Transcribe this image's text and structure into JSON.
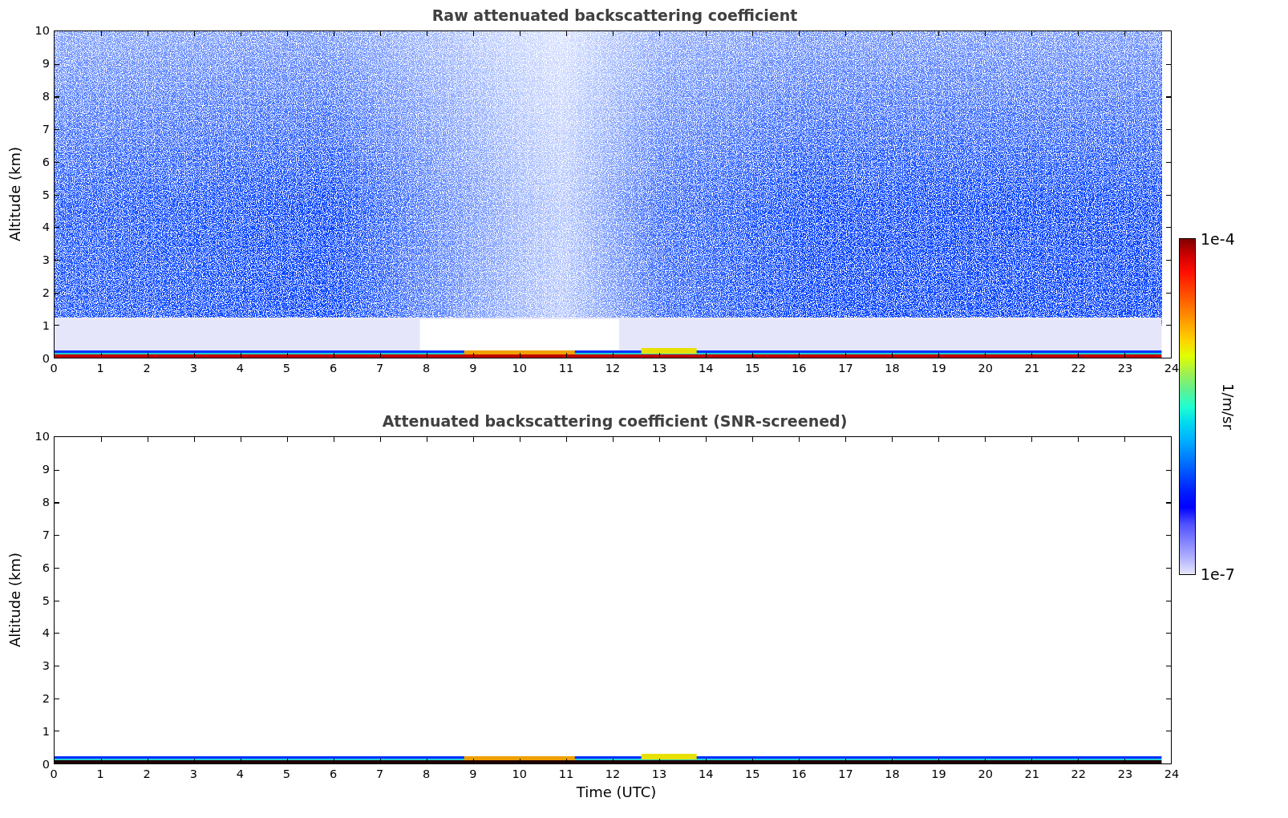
{
  "panels": [
    {
      "kind": "raw",
      "title": "Raw attenuated backscattering coefficient",
      "ylabel": "Altitude (km)",
      "yticks": [
        "10",
        "9",
        "8",
        "7",
        "6",
        "5",
        "4",
        "3",
        "2",
        "1",
        "0"
      ],
      "xticks": [
        "0",
        "1",
        "2",
        "3",
        "4",
        "5",
        "6",
        "7",
        "8",
        "9",
        "10",
        "11",
        "12",
        "13",
        "14",
        "15",
        "16",
        "17",
        "18",
        "19",
        "20",
        "21",
        "22",
        "23",
        "24"
      ]
    },
    {
      "kind": "screened",
      "title": "Attenuated backscattering coefficient (SNR-screened)",
      "ylabel": "Altitude (km)",
      "yticks": [
        "10",
        "9",
        "8",
        "7",
        "6",
        "5",
        "4",
        "3",
        "2",
        "1",
        "0"
      ],
      "xticks": [
        "0",
        "1",
        "2",
        "3",
        "4",
        "5",
        "6",
        "7",
        "8",
        "9",
        "10",
        "11",
        "12",
        "13",
        "14",
        "15",
        "16",
        "17",
        "18",
        "19",
        "20",
        "21",
        "22",
        "23",
        "24"
      ],
      "xlabel": "Time (UTC)"
    }
  ],
  "colorbar": {
    "max_label": "1e-4",
    "min_label": "1e-7",
    "label": "1/m/sr"
  }
}
